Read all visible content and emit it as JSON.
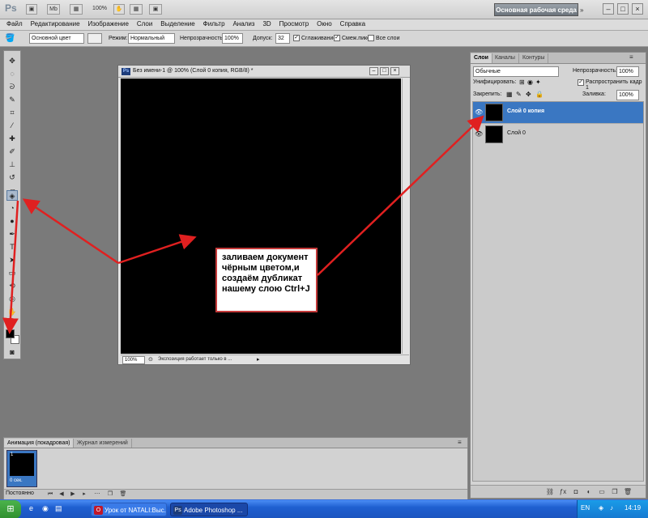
{
  "app": {
    "logo": "Ps",
    "mb_buttons": [
      "▣",
      "Mb",
      "▦",
      "100%",
      "✋",
      "▦",
      "▣"
    ],
    "workspace_label": "Основная рабочая среда",
    "window_controls": [
      "–",
      "□",
      "×"
    ]
  },
  "menus": [
    "Файл",
    "Редактирование",
    "Изображение",
    "Слои",
    "Выделение",
    "Фильтр",
    "Анализ",
    "3D",
    "Просмотр",
    "Окно",
    "Справка"
  ],
  "options": {
    "preset": "Основной цвет",
    "mode_label": "Режим:",
    "mode_value": "Нормальный",
    "opacity_label": "Непрозрачность:",
    "opacity_value": "100%",
    "tolerance_label": "Допуск:",
    "tolerance_value": "32",
    "antialias_label": "Сглаживание",
    "contiguous_label": "Смеж.пикс",
    "all_layers_label": "Все слои"
  },
  "document": {
    "title": "Без имени-1 @ 100% (Слой 0 копия, RGB/8) *",
    "zoom": "100%",
    "status": "Экспозиция работает только в ..."
  },
  "annotation": {
    "text": "заливаем документ чёрным цветом,и создаём дубликат нашему слою Ctrl+J"
  },
  "layers_panel": {
    "tabs": [
      "Слои",
      "Каналы",
      "Контуры"
    ],
    "blend_mode": "Обычные",
    "opacity_label": "Непрозрачность:",
    "opacity_value": "100%",
    "unify_label": "Унифицировать:",
    "propagate_label": "Распространить кадр 1",
    "lock_label": "Закрепить:",
    "fill_label": "Заливка:",
    "fill_value": "100%",
    "layers": [
      {
        "name": "Слой 0 копия",
        "selected": true
      },
      {
        "name": "Слой 0",
        "selected": false
      }
    ]
  },
  "animation_panel": {
    "tabs": [
      "Анимация (покадровая)",
      "Журнал измерений"
    ],
    "frame_number": "1",
    "frame_time": "0 сек.",
    "loop": "Постоянно"
  },
  "taskbar": {
    "items": [
      {
        "label": "Урок от NATALI:Выс...",
        "icon": "O"
      },
      {
        "label": "Adobe Photoshop ...",
        "icon": "Ps"
      }
    ],
    "lang": "EN",
    "clock": "14:19"
  },
  "colors": {
    "selection_blue": "#3a77c2",
    "arrow_red": "#e02020",
    "taskbar_blue": "#1f5fd0"
  }
}
